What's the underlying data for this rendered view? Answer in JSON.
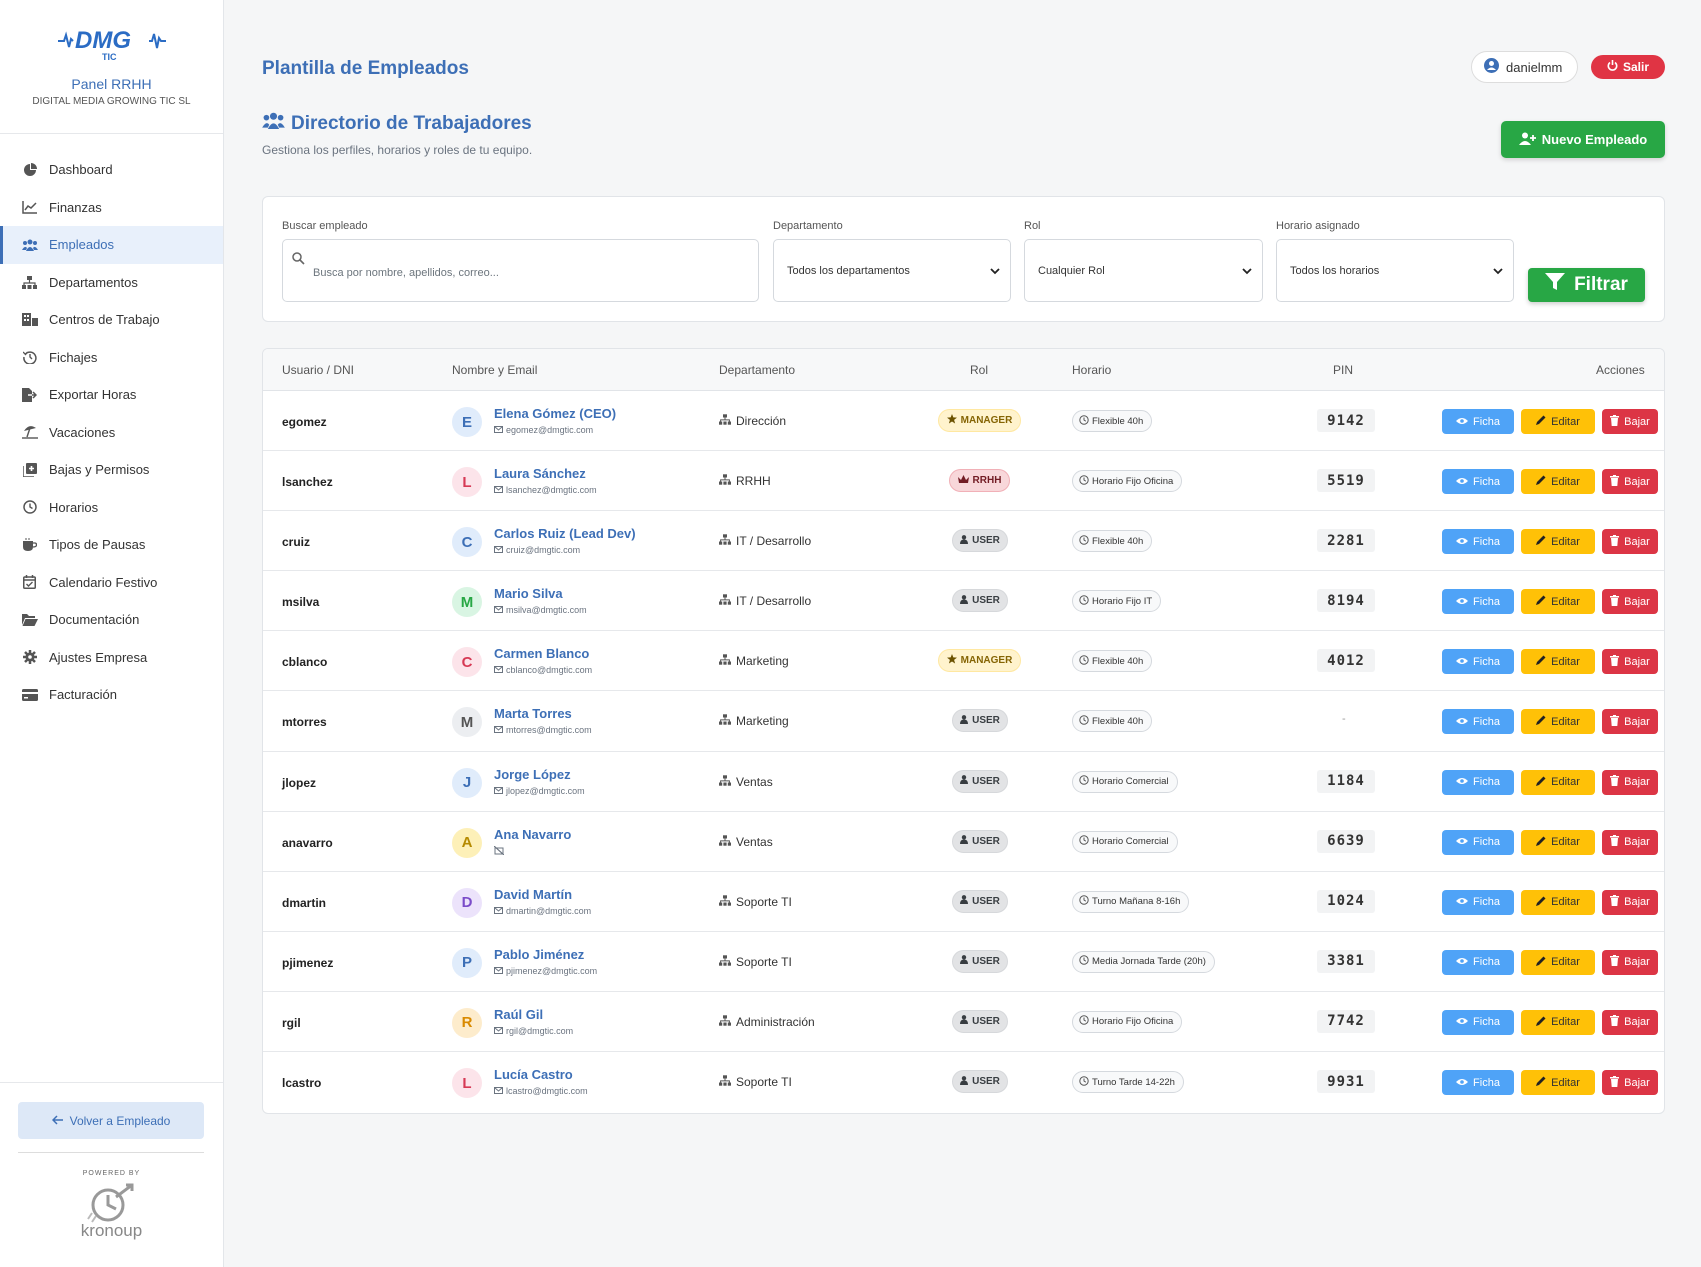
{
  "sidebar": {
    "logo_text": "DMG",
    "logo_sub": "TIC",
    "panel_title": "Panel RRHH",
    "company": "DIGITAL MEDIA GROWING TIC SL",
    "items": [
      {
        "label": "Dashboard",
        "icon": "pie-chart-icon"
      },
      {
        "label": "Finanzas",
        "icon": "line-chart-icon"
      },
      {
        "label": "Empleados",
        "icon": "users-icon",
        "active": true
      },
      {
        "label": "Departamentos",
        "icon": "sitemap-icon"
      },
      {
        "label": "Centros de Trabajo",
        "icon": "building-icon"
      },
      {
        "label": "Fichajes",
        "icon": "history-icon"
      },
      {
        "label": "Exportar Horas",
        "icon": "file-export-icon"
      },
      {
        "label": "Vacaciones",
        "icon": "umbrella-beach-icon"
      },
      {
        "label": "Bajas y Permisos",
        "icon": "notes-medical-icon"
      },
      {
        "label": "Horarios",
        "icon": "clock-icon"
      },
      {
        "label": "Tipos de Pausas",
        "icon": "coffee-icon"
      },
      {
        "label": "Calendario Festivo",
        "icon": "calendar-check-icon"
      },
      {
        "label": "Documentación",
        "icon": "folder-open-icon"
      },
      {
        "label": "Ajustes Empresa",
        "icon": "gear-icon"
      },
      {
        "label": "Facturación",
        "icon": "credit-card-icon"
      }
    ],
    "back_label": "Volver a Empleado",
    "powered_by": "POWERED BY",
    "brand": "kronoup"
  },
  "header": {
    "title": "Plantilla de Empleados",
    "user": "danielmm",
    "logout": "Salir"
  },
  "section": {
    "title": "Directorio de Trabajadores",
    "subtitle": "Gestiona los perfiles, horarios y roles de tu equipo.",
    "new_button": "Nuevo Empleado"
  },
  "filters": {
    "search_label": "Buscar empleado",
    "search_placeholder": "Busca por nombre, apellidos, correo...",
    "dept_label": "Departamento",
    "dept_value": "Todos los departamentos",
    "role_label": "Rol",
    "role_value": "Cualquier Rol",
    "schedule_label": "Horario asignado",
    "schedule_value": "Todos los horarios",
    "filter_button": "Filtrar"
  },
  "table": {
    "headers": [
      "Usuario / DNI",
      "Nombre y Email",
      "Departamento",
      "Rol",
      "Horario",
      "PIN",
      "Acciones"
    ],
    "action_labels": {
      "view": "Ficha",
      "edit": "Editar",
      "remove": "Bajar"
    },
    "rows": [
      {
        "user": "egomez",
        "initial": "E",
        "name": "Elena Gómez (CEO)",
        "email": "egomez@dmgtic.com",
        "dept": "Dirección",
        "role": "MANAGER",
        "role_type": "manager",
        "schedule": "Flexible 40h",
        "pin": "9142",
        "avatar_bg": "#e0ecfb",
        "avatar_fg": "#3d6fb6"
      },
      {
        "user": "lsanchez",
        "initial": "L",
        "name": "Laura Sánchez",
        "email": "lsanchez@dmgtic.com",
        "dept": "RRHH",
        "role": "RRHH",
        "role_type": "rrhh",
        "schedule": "Horario Fijo Oficina",
        "pin": "5519",
        "avatar_bg": "#fce4ea",
        "avatar_fg": "#d63a55"
      },
      {
        "user": "cruiz",
        "initial": "C",
        "name": "Carlos Ruiz (Lead Dev)",
        "email": "cruiz@dmgtic.com",
        "dept": "IT / Desarrollo",
        "role": "USER",
        "role_type": "user",
        "schedule": "Flexible 40h",
        "pin": "2281",
        "avatar_bg": "#e0ecfb",
        "avatar_fg": "#3d6fb6"
      },
      {
        "user": "msilva",
        "initial": "M",
        "name": "Mario Silva",
        "email": "msilva@dmgtic.com",
        "dept": "IT / Desarrollo",
        "role": "USER",
        "role_type": "user",
        "schedule": "Horario Fijo IT",
        "pin": "8194",
        "avatar_bg": "#d9f5e3",
        "avatar_fg": "#28a745"
      },
      {
        "user": "cblanco",
        "initial": "C",
        "name": "Carmen Blanco",
        "email": "cblanco@dmgtic.com",
        "dept": "Marketing",
        "role": "MANAGER",
        "role_type": "manager",
        "schedule": "Flexible 40h",
        "pin": "4012",
        "avatar_bg": "#fce4ea",
        "avatar_fg": "#d63a55"
      },
      {
        "user": "mtorres",
        "initial": "M",
        "name": "Marta Torres",
        "email": "mtorres@dmgtic.com",
        "dept": "Marketing",
        "role": "USER",
        "role_type": "user",
        "schedule": "Flexible 40h",
        "pin": "-",
        "avatar_bg": "#eceef1",
        "avatar_fg": "#555"
      },
      {
        "user": "jlopez",
        "initial": "J",
        "name": "Jorge López",
        "email": "jlopez@dmgtic.com",
        "dept": "Ventas",
        "role": "USER",
        "role_type": "user",
        "schedule": "Horario Comercial",
        "pin": "1184",
        "avatar_bg": "#e0ecfb",
        "avatar_fg": "#3d6fb6"
      },
      {
        "user": "anavarro",
        "initial": "A",
        "name": "Ana Navarro",
        "email": "",
        "dept": "Ventas",
        "role": "USER",
        "role_type": "user",
        "schedule": "Horario Comercial",
        "pin": "6639",
        "avatar_bg": "#fdf0b8",
        "avatar_fg": "#b58a00"
      },
      {
        "user": "dmartin",
        "initial": "D",
        "name": "David Martín",
        "email": "dmartin@dmgtic.com",
        "dept": "Soporte TI",
        "role": "USER",
        "role_type": "user",
        "schedule": "Turno Mañana 8-16h",
        "pin": "1024",
        "avatar_bg": "#ece3fb",
        "avatar_fg": "#7b4cc9"
      },
      {
        "user": "pjimenez",
        "initial": "P",
        "name": "Pablo Jiménez",
        "email": "pjimenez@dmgtic.com",
        "dept": "Soporte TI",
        "role": "USER",
        "role_type": "user",
        "schedule": "Media Jornada Tarde (20h)",
        "pin": "3381",
        "avatar_bg": "#e0ecfb",
        "avatar_fg": "#3d6fb6"
      },
      {
        "user": "rgil",
        "initial": "R",
        "name": "Raúl Gil",
        "email": "rgil@dmgtic.com",
        "dept": "Administración",
        "role": "USER",
        "role_type": "user",
        "schedule": "Horario Fijo Oficina",
        "pin": "7742",
        "avatar_bg": "#fdeccc",
        "avatar_fg": "#d98a00"
      },
      {
        "user": "lcastro",
        "initial": "L",
        "name": "Lucía Castro",
        "email": "lcastro@dmgtic.com",
        "dept": "Soporte TI",
        "role": "USER",
        "role_type": "user",
        "schedule": "Turno Tarde 14-22h",
        "pin": "9931",
        "avatar_bg": "#fce4ea",
        "avatar_fg": "#d63a55"
      }
    ]
  },
  "colors": {
    "primary": "#3d6fb6",
    "success": "#28a745",
    "danger": "#dc3545",
    "warning": "#ffc107",
    "info": "#4fa3f7"
  }
}
